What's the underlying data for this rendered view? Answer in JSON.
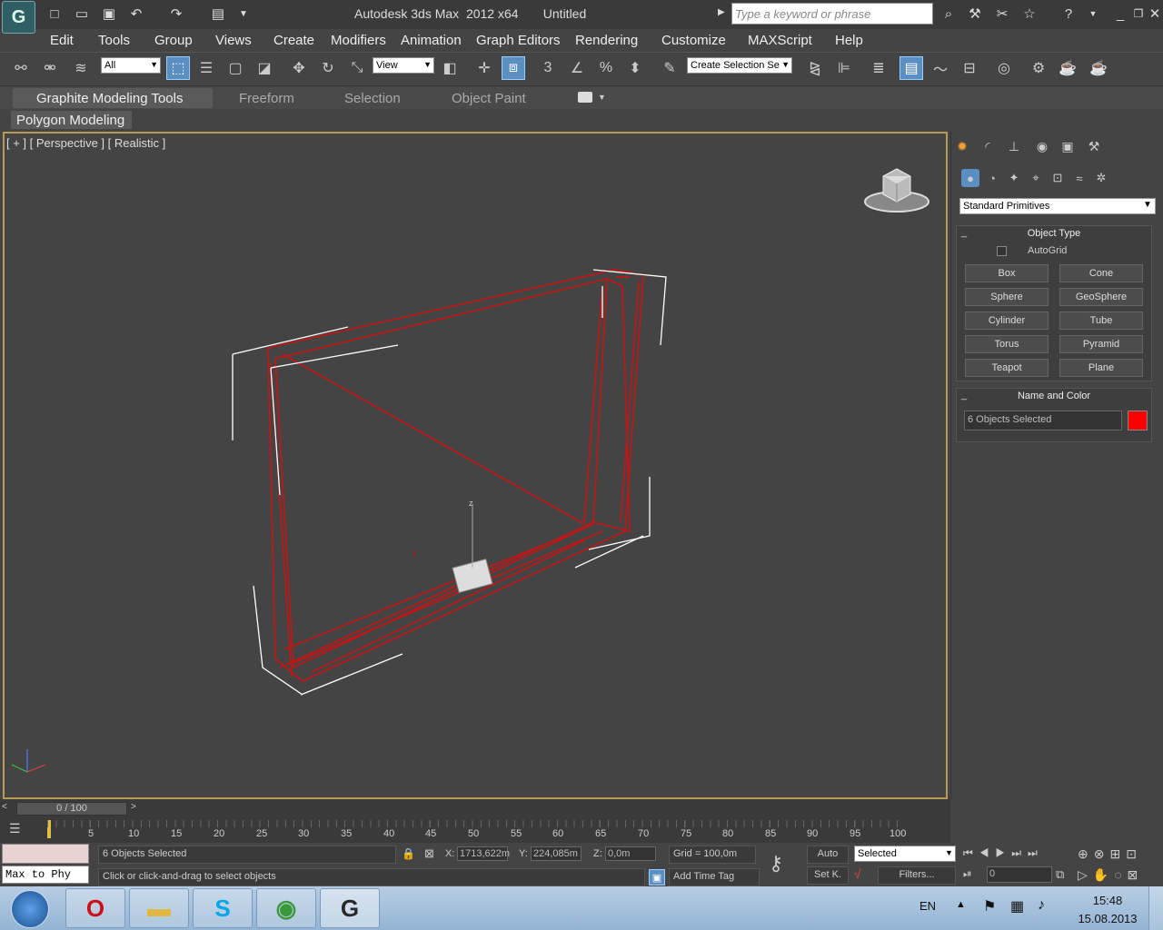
{
  "app": {
    "logo_glyph": "G",
    "title": "Autodesk 3ds Max  2012 x64       Untitled"
  },
  "search": {
    "placeholder": "Type a keyword or phrase"
  },
  "quick_access": [
    {
      "icon": "new-file-icon",
      "glyph": "□"
    },
    {
      "icon": "open-folder-icon",
      "glyph": "▭"
    },
    {
      "icon": "save-icon",
      "glyph": "▣"
    },
    {
      "icon": "undo-icon",
      "glyph": "↶"
    },
    {
      "icon": "redo-icon",
      "glyph": "↷"
    },
    {
      "icon": "project-folder-icon",
      "glyph": "▤"
    }
  ],
  "menu": [
    "Edit",
    "Tools",
    "Group",
    "Views",
    "Create",
    "Modifiers",
    "Animation",
    "Graph Editors",
    "Rendering",
    "Customize",
    "MAXScript",
    "Help"
  ],
  "toolbar": {
    "filter_value": "All",
    "ref_coord_value": "View",
    "selection_set_value": "Create Selection Se",
    "snap_label": "3",
    "angle_snap_label": "%"
  },
  "ribbon": {
    "tabs": [
      "Graphite Modeling Tools",
      "Freeform",
      "Selection",
      "Object Paint"
    ],
    "panel_label": "Polygon Modeling"
  },
  "viewport": {
    "label": "[ + ] [ Perspective ] [ Realistic ]"
  },
  "command_panel": {
    "category_value": "Standard Primitives",
    "object_type": {
      "title": "Object Type",
      "autogrid_label": "AutoGrid",
      "buttons": [
        "Box",
        "Cone",
        "Sphere",
        "GeoSphere",
        "Cylinder",
        "Tube",
        "Torus",
        "Pyramid",
        "Teapot",
        "Plane"
      ]
    },
    "name_color": {
      "title": "Name and Color",
      "name_value": "6 Objects Selected",
      "color": "#ff0000"
    }
  },
  "time": {
    "slider_label": "0 / 100",
    "ticks": [
      "5",
      "10",
      "15",
      "20",
      "25",
      "30",
      "35",
      "40",
      "45",
      "50",
      "55",
      "60",
      "65",
      "70",
      "75",
      "80",
      "85",
      "90",
      "95",
      "100"
    ]
  },
  "status": {
    "listener_text": "Max to Phy",
    "selection_text": "6 Objects Selected",
    "prompt_text": "Click or click-and-drag to select objects",
    "x_label": "X:",
    "x_value": "1713,622m",
    "y_label": "Y:",
    "y_value": "224,085m",
    "z_label": "Z:",
    "z_value": "0,0m",
    "grid_text": "Grid = 100,0m",
    "add_time_tag": "Add Time Tag",
    "auto_key": "Auto",
    "set_key": "Set K.",
    "key_mode_value": "Selected",
    "filters": "Filters...",
    "frame_value": "0"
  },
  "taskbar": {
    "lang": "EN",
    "time": "15:48",
    "date": "15.08.2013",
    "apps": [
      {
        "icon": "opera-icon",
        "glyph": "O",
        "color": "#cc0f16"
      },
      {
        "icon": "explorer-folder-icon",
        "glyph": "▬",
        "color": "#e0b840"
      },
      {
        "icon": "skype-icon",
        "glyph": "S",
        "color": "#00a8e8"
      },
      {
        "icon": "chrome-icon",
        "glyph": "◉",
        "color": "#3a9a3a"
      },
      {
        "icon": "3dsmax-icon",
        "glyph": "G",
        "color": "#2a2a2a"
      }
    ]
  },
  "colors": {
    "selection_red": "#c81414",
    "viewport_border": "#b89a50",
    "accent_blue": "#5b8fc2"
  }
}
